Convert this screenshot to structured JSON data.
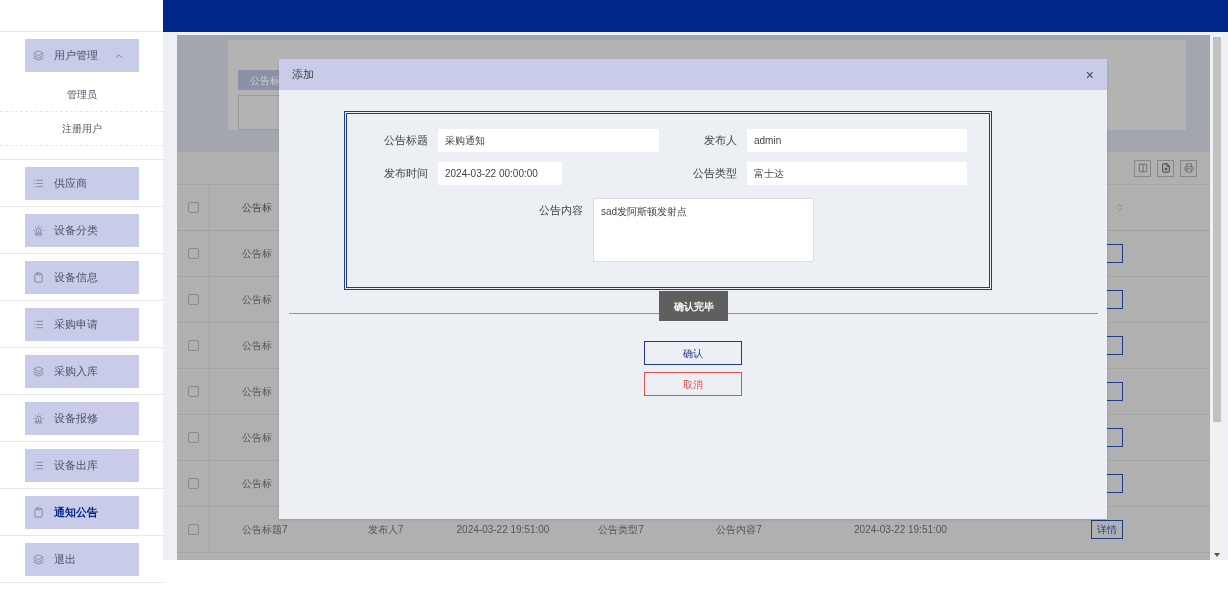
{
  "sidebar": {
    "items": [
      {
        "label": "用户管理",
        "kind": "layers",
        "selected": false,
        "expanded": true,
        "children": [
          {
            "label": "管理员"
          },
          {
            "label": "注册用户"
          }
        ]
      },
      {
        "label": "供应商",
        "kind": "list",
        "selected": false
      },
      {
        "label": "设备分类",
        "kind": "alarm",
        "selected": false
      },
      {
        "label": "设备信息",
        "kind": "clipboard",
        "selected": false
      },
      {
        "label": "采购申请",
        "kind": "list",
        "selected": false
      },
      {
        "label": "采购入库",
        "kind": "layers",
        "selected": false
      },
      {
        "label": "设备报修",
        "kind": "alarm",
        "selected": false
      },
      {
        "label": "设备出库",
        "kind": "list",
        "selected": false
      },
      {
        "label": "通知公告",
        "kind": "clipboard",
        "selected": true
      },
      {
        "label": "退出",
        "kind": "layers",
        "selected": false
      }
    ]
  },
  "filter": {
    "button": "公告标"
  },
  "table": {
    "header": {
      "checked": false,
      "label": "公告标"
    },
    "rows": [
      {
        "checked": false,
        "cells": [
          "公告标"
        ]
      },
      {
        "checked": false,
        "cells": [
          "公告标"
        ]
      },
      {
        "checked": false,
        "cells": [
          "公告标"
        ]
      },
      {
        "checked": false,
        "cells": [
          "公告标"
        ]
      },
      {
        "checked": false,
        "cells": [
          "公告标"
        ]
      },
      {
        "checked": false,
        "cells": [
          "公告标"
        ]
      },
      {
        "checked": false,
        "cells": [
          "公告标题7",
          "发布人7",
          "2024-03-22 19:51:00",
          "公告类型7",
          "公告内容7",
          "2024-03-22 19:51:00"
        ],
        "action": "详情"
      }
    ]
  },
  "dialog": {
    "title": "添加",
    "close": "×",
    "fields": [
      {
        "label": "公告标题",
        "value": "采购通知"
      },
      {
        "label": "发布人",
        "value": "admin"
      },
      {
        "label": "发布时间",
        "value": "2024-03-22 00:00:00"
      },
      {
        "label": "公告类型",
        "value": "富士达"
      },
      {
        "label": "公告内容",
        "value": "sad发阿斯顿发射点"
      }
    ],
    "done_button": "确认完毕",
    "confirm_button": "确认",
    "cancel_button": "取消"
  }
}
